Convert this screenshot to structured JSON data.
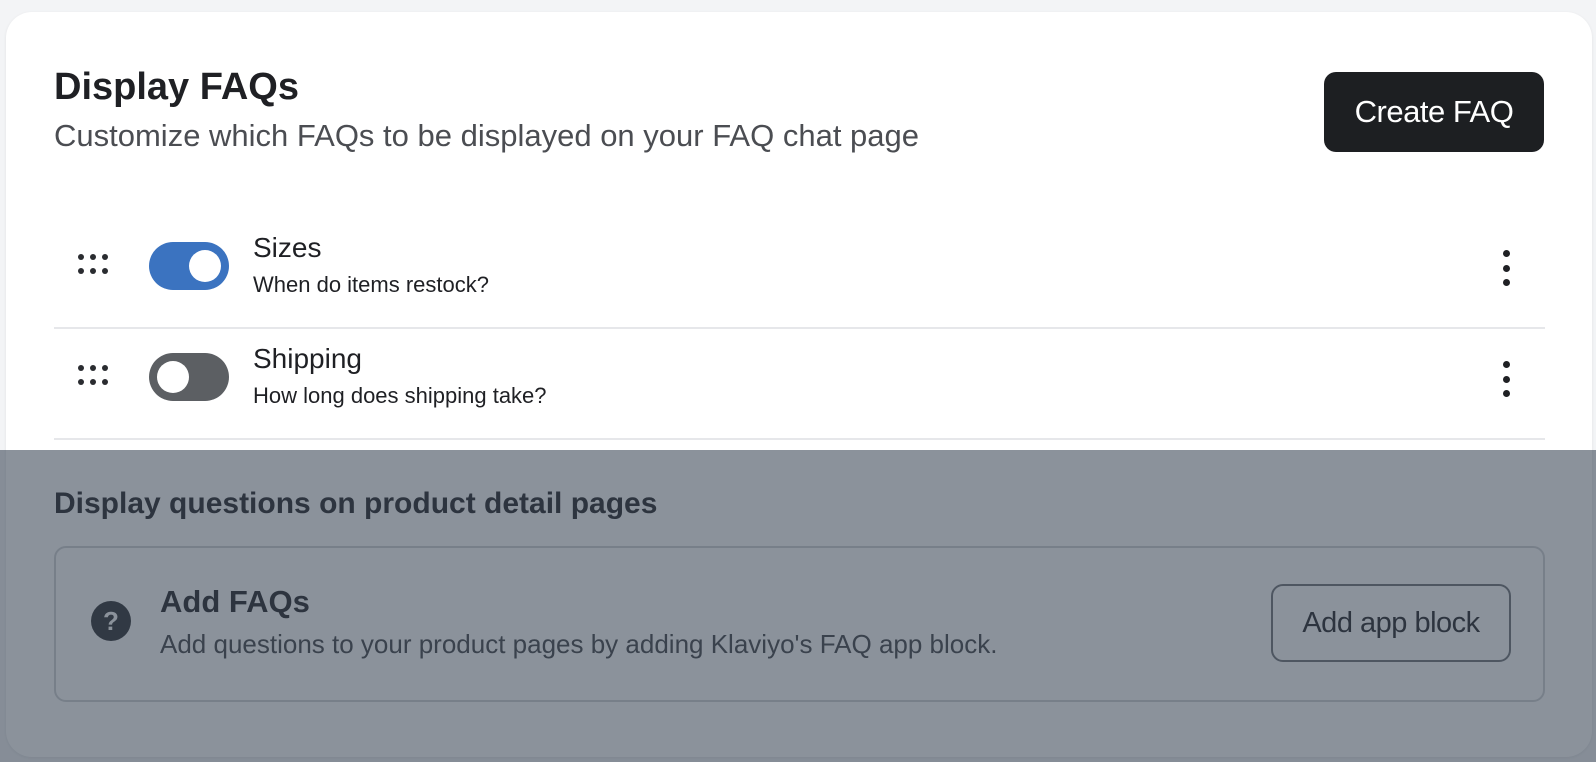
{
  "display_faqs": {
    "title": "Display FAQs",
    "subtitle": "Customize which FAQs to be displayed on your FAQ chat page",
    "create_button": "Create FAQ"
  },
  "faqs": [
    {
      "title": "Sizes",
      "question": "When do items restock?",
      "enabled": true,
      "drag_icon": "drag-handle-icon",
      "menu_icon": "more-vertical-icon"
    },
    {
      "title": "Shipping",
      "question": "How long does shipping take?",
      "enabled": false,
      "drag_icon": "drag-handle-icon",
      "menu_icon": "more-vertical-icon"
    }
  ],
  "product_pages": {
    "title": "Display questions on product detail pages",
    "block_icon": "help-circle-icon",
    "block_title": "Add FAQs",
    "block_description": "Add questions to your product pages by adding Klaviyo's FAQ app block.",
    "add_button": "Add app block"
  },
  "colors": {
    "toggle_on": "#3b73c0",
    "toggle_off": "#5c5f63",
    "primary_button": "#1d1f22",
    "overlay": "rgba(55, 68, 82, 0.58)"
  }
}
